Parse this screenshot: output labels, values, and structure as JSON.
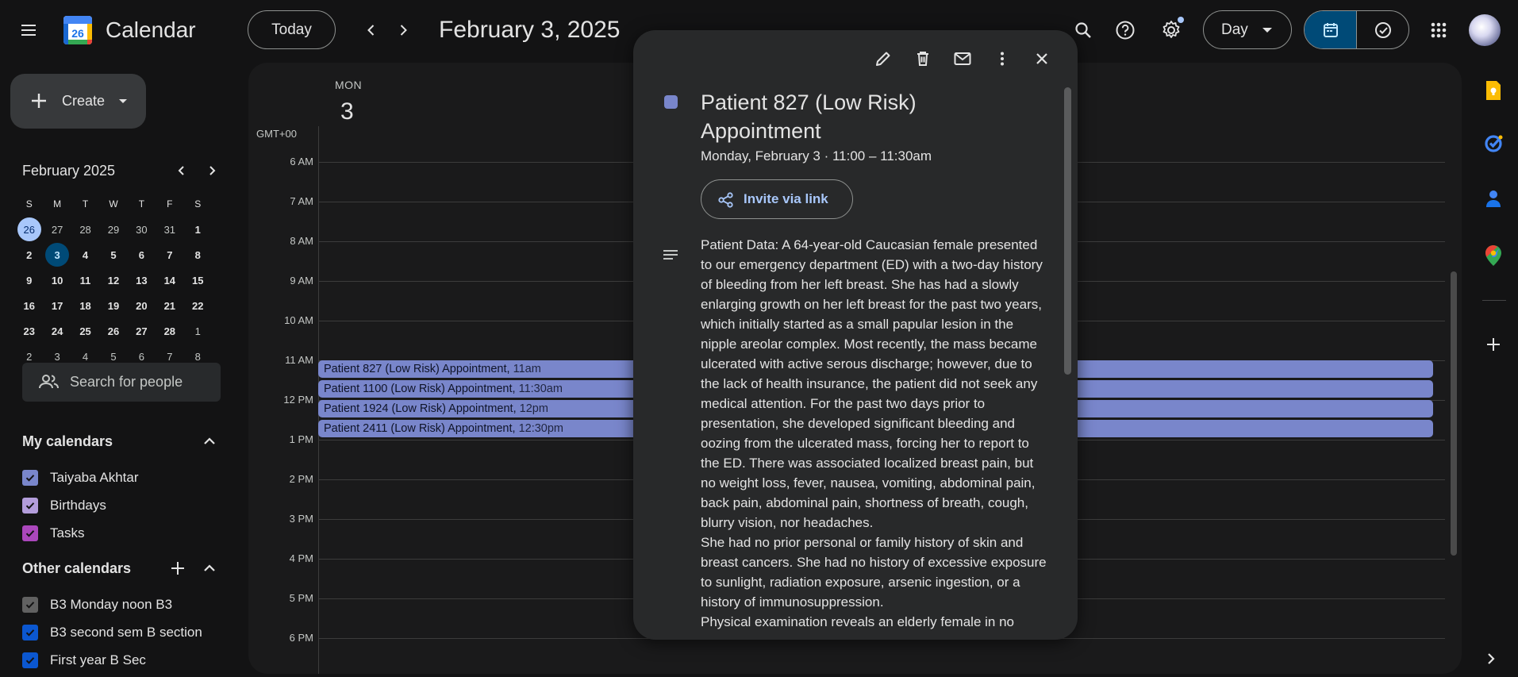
{
  "app": {
    "title": "Calendar",
    "logo_day": "26"
  },
  "header": {
    "today_label": "Today",
    "date_title": "February 3, 2025",
    "view_label": "Day"
  },
  "create": {
    "label": "Create"
  },
  "mini_calendar": {
    "title": "February 2025",
    "day_headers": [
      "S",
      "M",
      "T",
      "W",
      "T",
      "F",
      "S"
    ],
    "weeks": [
      [
        "26",
        "27",
        "28",
        "29",
        "30",
        "31",
        "1"
      ],
      [
        "2",
        "3",
        "4",
        "5",
        "6",
        "7",
        "8"
      ],
      [
        "9",
        "10",
        "11",
        "12",
        "13",
        "14",
        "15"
      ],
      [
        "16",
        "17",
        "18",
        "19",
        "20",
        "21",
        "22"
      ],
      [
        "23",
        "24",
        "25",
        "26",
        "27",
        "28",
        "1"
      ],
      [
        "2",
        "3",
        "4",
        "5",
        "6",
        "7",
        "8"
      ]
    ]
  },
  "search_people": {
    "placeholder": "Search for people"
  },
  "my_calendars": {
    "title": "My calendars",
    "items": [
      {
        "label": "Taiyaba Akhtar",
        "color": "#7986cb"
      },
      {
        "label": "Birthdays",
        "color": "#b39ddb"
      },
      {
        "label": "Tasks",
        "color": "#ab47bc"
      }
    ]
  },
  "other_calendars": {
    "title": "Other calendars",
    "items": [
      {
        "label": "B3 Monday noon B3",
        "color": "#616161"
      },
      {
        "label": "B3 second sem B section",
        "color": "#0b57d0"
      },
      {
        "label": "First year B Sec",
        "color": "#0b57d0"
      }
    ]
  },
  "day_view": {
    "dow": "MON",
    "day_number": "3",
    "timezone": "GMT+00",
    "hours": [
      "6 AM",
      "7 AM",
      "8 AM",
      "9 AM",
      "10 AM",
      "11 AM",
      "12 PM",
      "1 PM",
      "2 PM",
      "3 PM",
      "4 PM",
      "5 PM",
      "6 PM"
    ],
    "events": [
      {
        "title": "Patient 827 (Low Risk) Appointment",
        "time": "11am"
      },
      {
        "title": "Patient 1100 (Low Risk) Appointment",
        "time": "11:30am"
      },
      {
        "title": "Patient 1924 (Low Risk) Appointment",
        "time": "12pm"
      },
      {
        "title": "Patient 2411 (Low Risk) Appointment",
        "time": "12:30pm"
      }
    ]
  },
  "popup": {
    "title": "Patient 827 (Low Risk) Appointment",
    "subtitle": "Monday, February 3  ·  11:00 – 11:30am",
    "invite_label": "Invite via link",
    "description": "Patient Data: A 64-year-old Caucasian female presented to our emergency department (ED) with a two-day history of bleeding from her left breast. She has had a slowly enlarging growth on her left breast for the past two years, which initially started as a small papular lesion in the nipple areolar complex. Most recently, the mass became ulcerated with active serous discharge; however, due to the lack of health insurance, the patient did not seek any medical attention. For the past two days prior to presentation, she developed significant bleeding and oozing from the ulcerated mass, forcing her to report to the ED. There was associated localized breast pain, but no weight loss, fever, nausea, vomiting, abdominal pain, back pain, abdominal pain, shortness of breath, cough, blurry vision, nor headaches.\nShe had no prior personal or family history of skin and breast cancers. She had no history of excessive exposure to sunlight, radiation exposure, arsenic ingestion, or a history of immunosuppression.\nPhysical examination reveals an elderly female in no",
    "event_color": "#7986cb"
  },
  "accent": {
    "selected_segment": "#004a77",
    "event": "#7986cb",
    "today_circle": "#a8c7fa"
  }
}
